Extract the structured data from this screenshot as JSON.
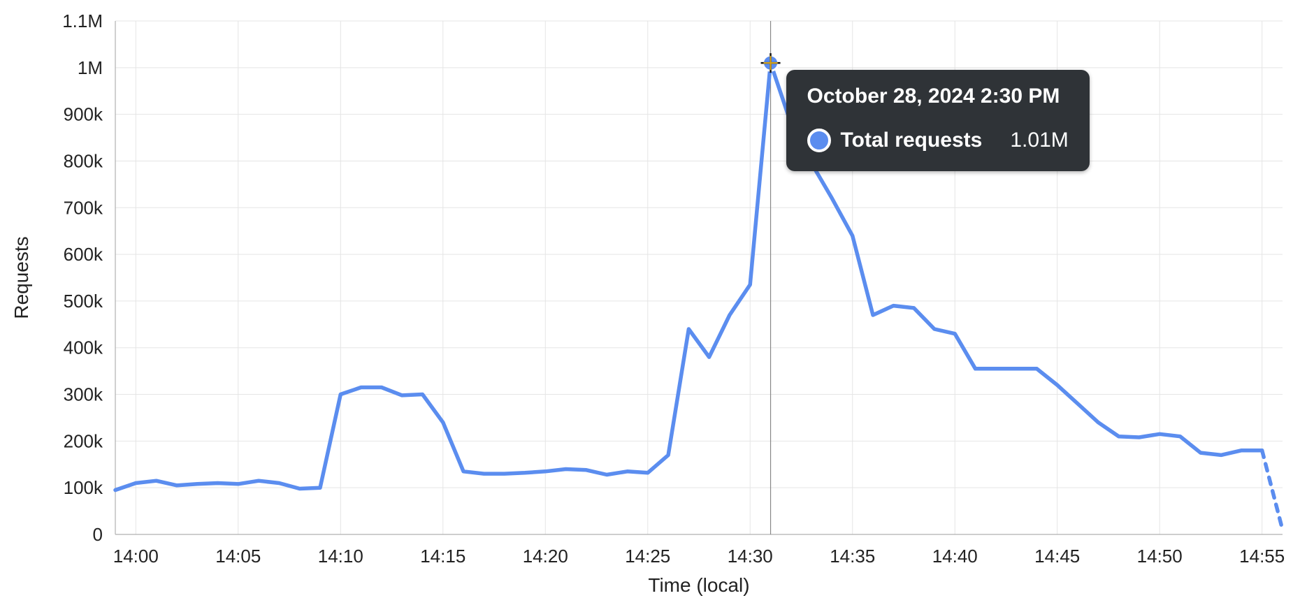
{
  "chart_data": {
    "type": "line",
    "xlabel": "Time (local)",
    "ylabel": "Requests",
    "ylim": [
      0,
      1100000
    ],
    "xlim_minutes": [
      -1,
      56
    ],
    "y_ticks": [
      {
        "v": 0,
        "label": "0"
      },
      {
        "v": 100000,
        "label": "100k"
      },
      {
        "v": 200000,
        "label": "200k"
      },
      {
        "v": 300000,
        "label": "300k"
      },
      {
        "v": 400000,
        "label": "400k"
      },
      {
        "v": 500000,
        "label": "500k"
      },
      {
        "v": 600000,
        "label": "600k"
      },
      {
        "v": 700000,
        "label": "700k"
      },
      {
        "v": 800000,
        "label": "800k"
      },
      {
        "v": 900000,
        "label": "900k"
      },
      {
        "v": 1000000,
        "label": "1M"
      },
      {
        "v": 1100000,
        "label": "1.1M"
      }
    ],
    "x_ticks_minutes": [
      0,
      5,
      10,
      15,
      20,
      25,
      30,
      35,
      40,
      45,
      50,
      55
    ],
    "x_tick_labels": [
      "14:00",
      "14:05",
      "14:10",
      "14:15",
      "14:20",
      "14:25",
      "14:30",
      "14:35",
      "14:40",
      "14:45",
      "14:50",
      "14:55"
    ],
    "series": [
      {
        "name": "Total requests",
        "color": "#5b8def",
        "x_minutes": [
          -1,
          0,
          1,
          2,
          3,
          4,
          5,
          6,
          7,
          8,
          9,
          10,
          11,
          12,
          13,
          14,
          15,
          16,
          17,
          18,
          19,
          20,
          21,
          22,
          23,
          24,
          25,
          26,
          27,
          28,
          29,
          30,
          31,
          32,
          33,
          34,
          35,
          36,
          37,
          38,
          39,
          40,
          41,
          42,
          43,
          44,
          45,
          46,
          47,
          48,
          49,
          50,
          51,
          52,
          53,
          54,
          55,
          56
        ],
        "values": [
          95000,
          110000,
          115000,
          105000,
          108000,
          110000,
          108000,
          115000,
          110000,
          98000,
          100000,
          300000,
          315000,
          315000,
          298000,
          300000,
          240000,
          135000,
          130000,
          130000,
          132000,
          135000,
          140000,
          138000,
          128000,
          135000,
          132000,
          170000,
          440000,
          380000,
          470000,
          535000,
          1010000,
          880000,
          795000,
          720000,
          640000,
          470000,
          490000,
          485000,
          440000,
          430000,
          355000,
          355000,
          355000,
          355000,
          320000,
          280000,
          240000,
          210000,
          208000,
          215000,
          210000,
          175000,
          170000,
          180000,
          180000,
          10000
        ],
        "dashed_from_index": 56
      }
    ],
    "hover": {
      "x_minute": 31,
      "title": "October 28, 2024 2:30 PM",
      "series_name": "Total requests",
      "value_label": "1.01M",
      "value": 1010000
    }
  },
  "tooltip": {
    "title": "October 28, 2024 2:30 PM",
    "series_label": "Total requests",
    "value_label": "1.01M"
  },
  "axis": {
    "x_title": "Time (local)",
    "y_title": "Requests"
  }
}
